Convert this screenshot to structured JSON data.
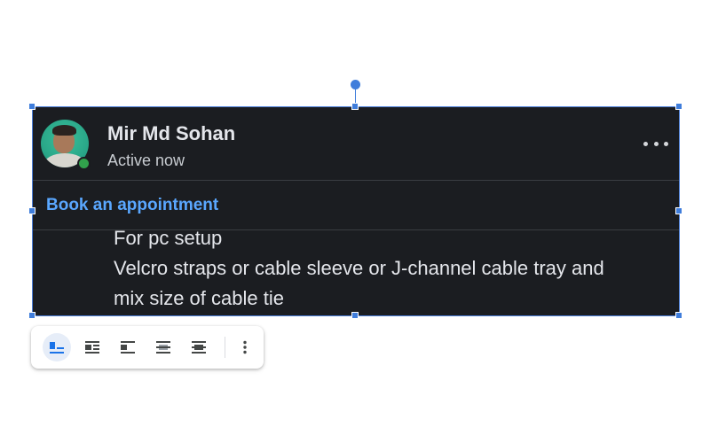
{
  "chat_card": {
    "contact_name": "Mir Md Sohan",
    "status_text": "Active now",
    "more_options_icon": "more-horizontal-icon",
    "status_color": "#31a24c",
    "action_link": "Book an appointment",
    "message_lines": [
      "For pc setup",
      "Velcro straps or cable sleeve or J-channel cable tray and",
      "mix size of cable tie"
    ]
  },
  "colors": {
    "card_background": "#1b1d21",
    "link_color": "#5aa7ff",
    "selection_color": "#3f7ddb"
  },
  "image_toolbar": {
    "buttons": [
      {
        "icon": "inline-wrap-icon",
        "selected": true
      },
      {
        "icon": "wrap-text-icon",
        "selected": false
      },
      {
        "icon": "break-text-icon",
        "selected": false
      },
      {
        "icon": "behind-text-icon",
        "selected": false
      },
      {
        "icon": "in-front-of-text-icon",
        "selected": false
      },
      {
        "icon": "more-vertical-icon",
        "selected": false
      }
    ]
  }
}
